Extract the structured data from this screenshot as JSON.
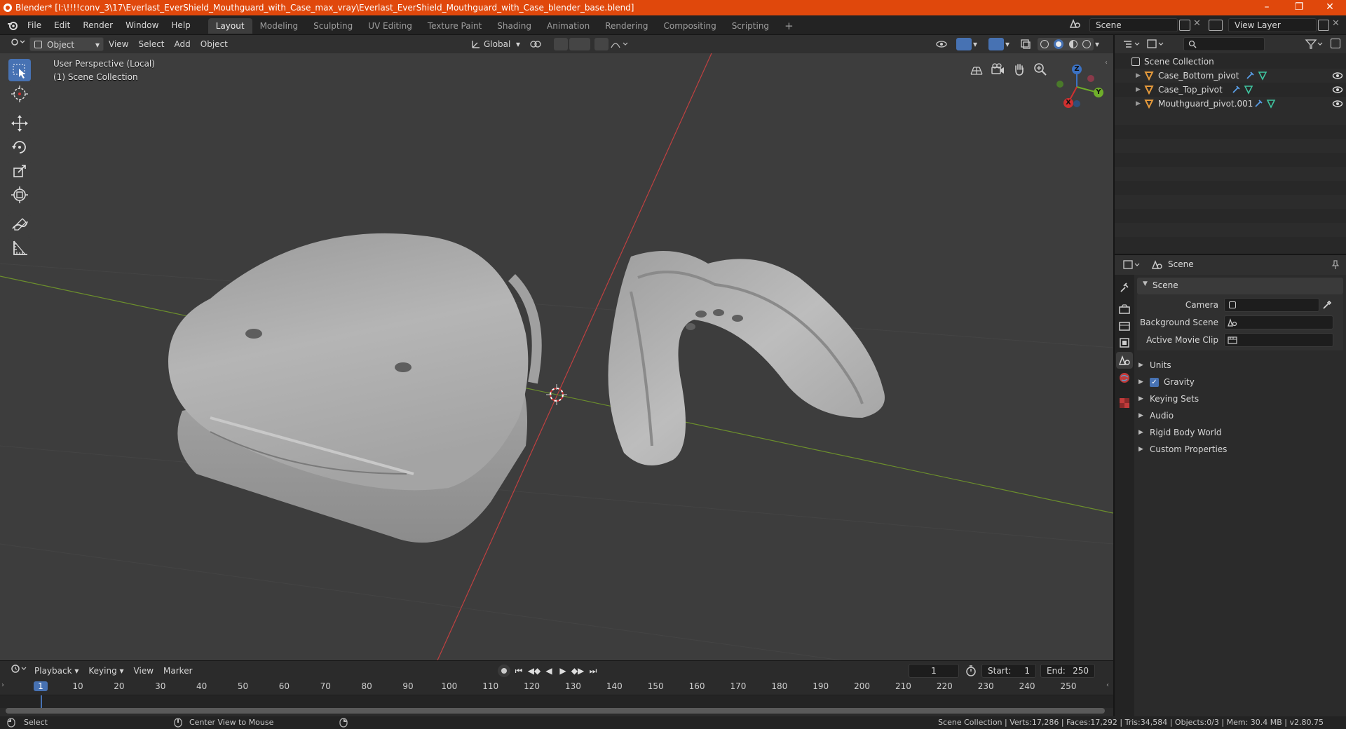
{
  "titlebar": {
    "title": "Blender* [I:\\!!!!conv_3\\17\\Everlast_EverShield_Mouthguard_with_Case_max_vray\\Everlast_EverShield_Mouthguard_with_Case_blender_base.blend]",
    "accent": "#e0480c"
  },
  "menu": {
    "items": [
      "File",
      "Edit",
      "Render",
      "Window",
      "Help"
    ]
  },
  "workspaces": {
    "tabs": [
      "Layout",
      "Modeling",
      "Sculpting",
      "UV Editing",
      "Texture Paint",
      "Shading",
      "Animation",
      "Rendering",
      "Compositing",
      "Scripting"
    ],
    "active": "Layout",
    "add": "+"
  },
  "scene_field": {
    "value": "Scene"
  },
  "view_layer_field": {
    "value": "View Layer"
  },
  "viewport_header": {
    "mode": "Object Mode",
    "menus": [
      "View",
      "Select",
      "Add",
      "Object"
    ],
    "orientation": "Global"
  },
  "viewport": {
    "perspective_label": "User Perspective (Local)",
    "collection_label": "(1) Scene Collection",
    "axis_x": "X",
    "axis_y": "Y",
    "axis_z": "Z"
  },
  "outliner": {
    "search_placeholder": "",
    "root": "Scene Collection",
    "items": [
      {
        "label": "Case_Bottom_pivot"
      },
      {
        "label": "Case_Top_pivot"
      },
      {
        "label": "Mouthguard_pivot.001"
      }
    ]
  },
  "properties": {
    "header_title": "Scene",
    "section_title": "Scene",
    "camera_label": "Camera",
    "background_scene_label": "Background Scene",
    "active_movie_clip_label": "Active Movie Clip",
    "panels": [
      {
        "label": "Units",
        "checkbox": false
      },
      {
        "label": "Gravity",
        "checkbox": true
      },
      {
        "label": "Keying Sets",
        "checkbox": false
      },
      {
        "label": "Audio",
        "checkbox": false
      },
      {
        "label": "Rigid Body World",
        "checkbox": false
      },
      {
        "label": "Custom Properties",
        "checkbox": false
      }
    ]
  },
  "timeline": {
    "menus": [
      "Playback",
      "Keying",
      "View",
      "Marker"
    ],
    "current_frame": "1",
    "start_label": "Start:",
    "start_value": "1",
    "end_label": "End:",
    "end_value": "250",
    "ticks": [
      "1",
      "10",
      "20",
      "30",
      "40",
      "50",
      "60",
      "70",
      "80",
      "90",
      "100",
      "110",
      "120",
      "130",
      "140",
      "150",
      "160",
      "170",
      "180",
      "190",
      "200",
      "210",
      "220",
      "230",
      "240",
      "250"
    ]
  },
  "statusbar": {
    "left_action": "Select",
    "middle_action": "Center View to Mouse",
    "stats": "Scene Collection | Verts:17,286 | Faces:17,292 | Tris:34,584 | Objects:0/3 | Mem: 30.4 MB | v2.80.75"
  }
}
